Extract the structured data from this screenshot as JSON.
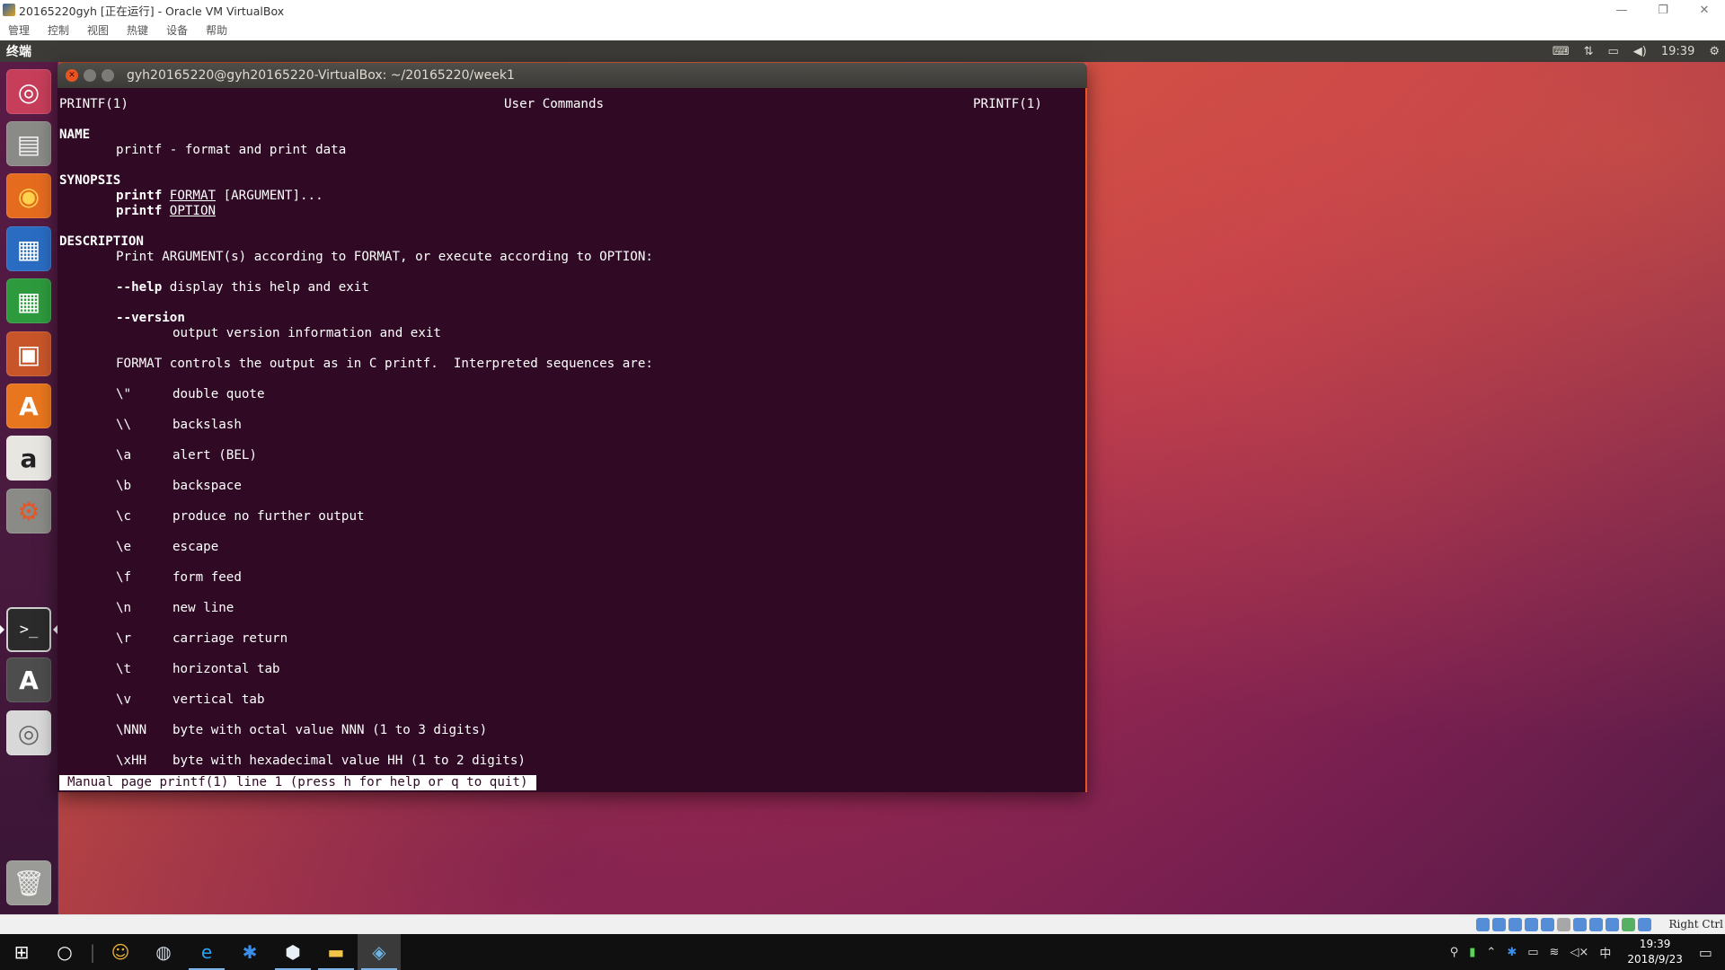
{
  "vbox": {
    "title": "20165220gyh [正在运行] - Oracle VM VirtualBox",
    "menu": [
      "管理",
      "控制",
      "视图",
      "热键",
      "设备",
      "帮助"
    ],
    "hostkey": "Right Ctrl"
  },
  "ubuntu": {
    "app_name": "终端",
    "clock": "19:39"
  },
  "terminal": {
    "title": "gyh20165220@gyh20165220-VirtualBox: ~/20165220/week1",
    "header_left": "PRINTF(1)",
    "header_center": "User Commands",
    "header_right": "PRINTF(1)",
    "name_heading": "NAME",
    "name_line": "printf - format and print data",
    "synopsis_heading": "SYNOPSIS",
    "syn1_cmd": "printf",
    "syn1_arg1": "FORMAT",
    "syn1_arg2": "[ARGUMENT]...",
    "syn2_cmd": "printf",
    "syn2_arg": "OPTION",
    "description_heading": "DESCRIPTION",
    "desc_line": "Print ARGUMENT(s) according to FORMAT, or execute according to OPTION:",
    "help_opt": "--help",
    "help_desc": "display this help and exit",
    "version_opt": "--version",
    "version_desc": "output version information and exit",
    "format_line": "FORMAT controls the output as in C printf.  Interpreted sequences are:",
    "sequences": [
      {
        "seq": "\\\"",
        "desc": "double quote"
      },
      {
        "seq": "\\\\",
        "desc": "backslash"
      },
      {
        "seq": "\\a",
        "desc": "alert (BEL)"
      },
      {
        "seq": "\\b",
        "desc": "backspace"
      },
      {
        "seq": "\\c",
        "desc": "produce no further output"
      },
      {
        "seq": "\\e",
        "desc": "escape"
      },
      {
        "seq": "\\f",
        "desc": "form feed"
      },
      {
        "seq": "\\n",
        "desc": "new line"
      },
      {
        "seq": "\\r",
        "desc": "carriage return"
      },
      {
        "seq": "\\t",
        "desc": "horizontal tab"
      },
      {
        "seq": "\\v",
        "desc": "vertical tab"
      },
      {
        "seq": "\\NNN",
        "desc": "byte with octal value NNN (1 to 3 digits)"
      },
      {
        "seq": "\\xHH",
        "desc": "byte with hexadecimal value HH (1 to 2 digits)"
      }
    ],
    "status_line": "Manual page printf(1) line 1 (press h for help or q to quit)"
  },
  "launcher": {
    "items": [
      {
        "icon": "ubuntu-dash-icon",
        "glyph": "◎",
        "bg": "#c63e5a"
      },
      {
        "icon": "files-icon",
        "glyph": "▤",
        "bg": "#8a8a86"
      },
      {
        "icon": "firefox-icon",
        "glyph": "◉",
        "bg": "#e56b1f"
      },
      {
        "icon": "libreoffice-writer-icon",
        "glyph": "▦",
        "bg": "#2a6cc2"
      },
      {
        "icon": "libreoffice-calc-icon",
        "glyph": "▦",
        "bg": "#2e9a3e"
      },
      {
        "icon": "libreoffice-impress-icon",
        "glyph": "▣",
        "bg": "#c8552a"
      },
      {
        "icon": "ubuntu-software-icon",
        "glyph": "A",
        "bg": "#e8761e"
      },
      {
        "icon": "amazon-icon",
        "glyph": "a",
        "bg": "#e8e6e1"
      },
      {
        "icon": "system-settings-icon",
        "glyph": "⚙",
        "bg": "#8a8a86"
      },
      {
        "icon": "terminal-icon",
        "glyph": ">_",
        "bg": "#2b2b2b"
      },
      {
        "icon": "software-updater-icon",
        "glyph": "A",
        "bg": "#4d4d4d"
      },
      {
        "icon": "dvd-icon",
        "glyph": "◎",
        "bg": "#d8d8d8"
      }
    ],
    "trash_icon": "trash-icon"
  },
  "taskbar": {
    "date": "2018/9/23",
    "time": "19:39",
    "ime": "中"
  },
  "colors": {
    "terminal_bg": "#300a24",
    "accent_orange": "#e95420",
    "panel": "#3c3b37"
  }
}
